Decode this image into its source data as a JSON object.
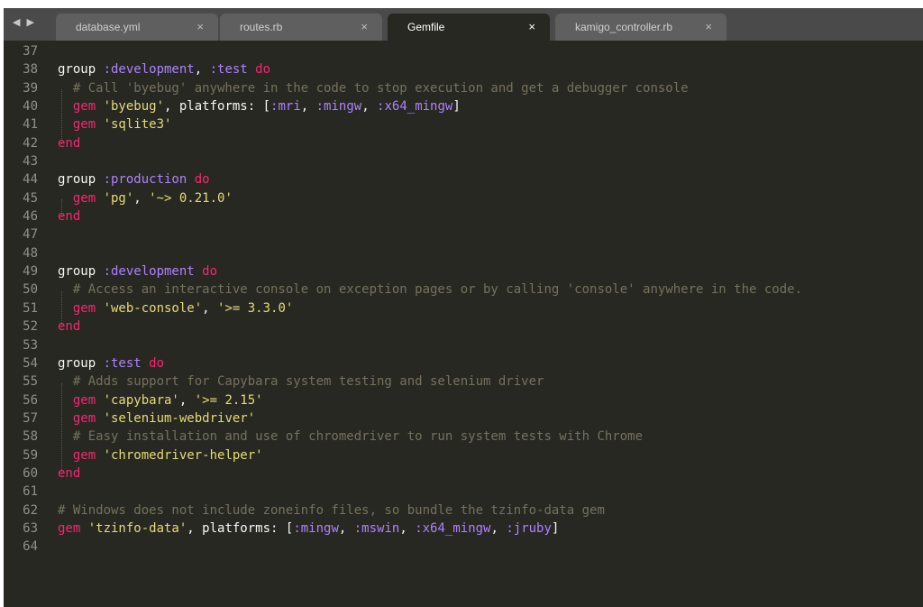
{
  "tabs": [
    {
      "label": "database.yml",
      "close": "×"
    },
    {
      "label": "routes.rb",
      "close": "×"
    },
    {
      "label": "Gemfile",
      "close": "×"
    },
    {
      "label": "kamigo_controller.rb",
      "close": "×"
    }
  ],
  "nav_arrows": "◀ ▶",
  "line_numbers": [
    "37",
    "38",
    "39",
    "40",
    "41",
    "42",
    "43",
    "44",
    "45",
    "46",
    "47",
    "48",
    "49",
    "50",
    "51",
    "52",
    "53",
    "54",
    "55",
    "56",
    "57",
    "58",
    "59",
    "60",
    "61",
    "62",
    "63",
    "64"
  ],
  "code": {
    "l38_group": "group ",
    "l38_sym1": ":development",
    "l38_sep": ", ",
    "l38_sym2": ":test",
    "l38_do": " do",
    "l39": "  # Call 'byebug' anywhere in the code to stop execution and get a debugger console",
    "l40_gem": "  gem ",
    "l40_str": "'byebug'",
    "l40_mid": ", platforms: [",
    "l40_s1": ":mri",
    "l40_c1": ", ",
    "l40_s2": ":mingw",
    "l40_c2": ", ",
    "l40_s3": ":x64_mingw",
    "l40_end": "]",
    "l41_gem": "  gem ",
    "l41_str": "'sqlite3'",
    "l42": "end",
    "l44_group": "group ",
    "l44_sym": ":production",
    "l44_do": " do",
    "l45_gem": "  gem ",
    "l45_s1": "'pg'",
    "l45_sep": ", ",
    "l45_s2": "'~> 0.21.0'",
    "l46": "end",
    "l49_group": "group ",
    "l49_sym": ":development",
    "l49_do": " do",
    "l50": "  # Access an interactive console on exception pages or by calling 'console' anywhere in the code.",
    "l51_gem": "  gem ",
    "l51_s1": "'web-console'",
    "l51_sep": ", ",
    "l51_s2": "'>= 3.3.0'",
    "l52": "end",
    "l54_group": "group ",
    "l54_sym": ":test",
    "l54_do": " do",
    "l55": "  # Adds support for Capybara system testing and selenium driver",
    "l56_gem": "  gem ",
    "l56_s1": "'capybara'",
    "l56_sep": ", ",
    "l56_s2": "'>= 2.15'",
    "l57_gem": "  gem ",
    "l57_str": "'selenium-webdriver'",
    "l58": "  # Easy installation and use of chromedriver to run system tests with Chrome",
    "l59_gem": "  gem ",
    "l59_str": "'chromedriver-helper'",
    "l60": "end",
    "l62": "# Windows does not include zoneinfo files, so bundle the tzinfo-data gem",
    "l63_gem": "gem ",
    "l63_str": "'tzinfo-data'",
    "l63_mid": ", platforms: [",
    "l63_s1": ":mingw",
    "l63_c1": ", ",
    "l63_s2": ":mswin",
    "l63_c2": ", ",
    "l63_s3": ":x64_mingw",
    "l63_c3": ", ",
    "l63_s4": ":jruby",
    "l63_end": "]"
  },
  "colors": {
    "background": "#272822",
    "keyword": "#f92672",
    "string": "#e6db74",
    "symbol": "#ae81ff",
    "comment": "#75715e",
    "text": "#f8f8f2"
  }
}
